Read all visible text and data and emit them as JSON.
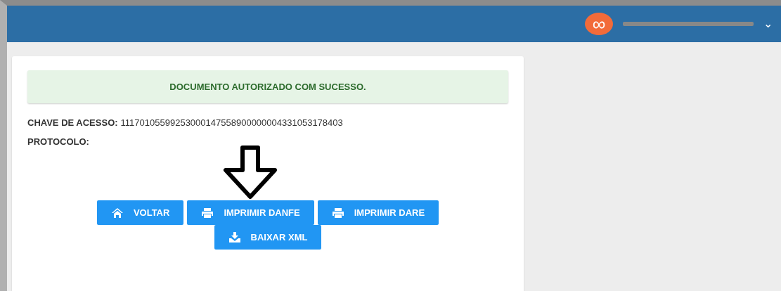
{
  "header": {
    "user_menu_icon": "∞",
    "user_name_redacted": true,
    "dropdown": "⌄"
  },
  "alert": {
    "message": "DOCUMENTO AUTORIZADO COM SUCESSO."
  },
  "fields": [
    {
      "label": "CHAVE DE ACESSO:",
      "value": "11170105599253000147558900000004331053178403"
    },
    {
      "label": "PROTOCOLO:"
    }
  ],
  "buttons": [
    {
      "label": "VOLTAR",
      "kind": "home",
      "arrow_annotation": false
    },
    {
      "label": "IMPRIMIR DANFE",
      "kind": "print",
      "arrow_annotation": true
    },
    {
      "label": "IMPRIMIR DARE",
      "kind": "print",
      "arrow_annotation": false
    },
    {
      "label": "BAIXAR XML",
      "kind": "download",
      "arrow_annotation": false
    }
  ]
}
